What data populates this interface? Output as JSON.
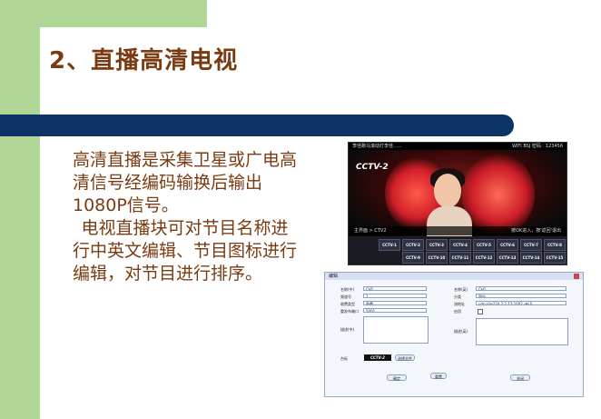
{
  "slide": {
    "title": "2、直播高清电视",
    "paragraph1": "高清直播是采集卫星或广电高清信号经编码输换后输出1080P信号。",
    "paragraph2": "电视直播块可对节目名称进行中英文编辑、节目图标进行编辑，对节目进行排序。"
  },
  "tv_screen": {
    "top_left_text": "李佳跑马滚动灯李佳……",
    "top_right_text": "WIFI BSJ 密码：123456",
    "logo": "CCTV-2",
    "nav_left": "主界面 > CTV2",
    "nav_right": "按OK进入，按'返回'退出",
    "channels": [
      "CCTV-1",
      "CCTV-2",
      "CCTV-3",
      "CCTV-4",
      "CCTV-5",
      "CCTV-6",
      "CCTV-7",
      "CCTV-8",
      "CCTV-9",
      "CCTV-10",
      "CCTV-11",
      "CCTV-12",
      "CCTV-13",
      "CCTV-14",
      "CCTV-15"
    ]
  },
  "dialog": {
    "title": "编辑",
    "labels": {
      "name_cn": "名称(中)",
      "channel_no": "频道号",
      "fee_type": "收费类型",
      "multicast_port": "重发布端口",
      "description_cn": "描述(中)",
      "icon": "台标",
      "name_en": "名称(英)",
      "category": "分类",
      "stream_url": "流地址",
      "enabled": "启用",
      "description_en": "描述(英)"
    },
    "values": {
      "name_cn": "CH1",
      "channel_no": "1",
      "fee_type": "免费",
      "multicast_port": "5001",
      "name_en": "CH1",
      "category": "国内",
      "stream_url": "udp://@224.2.2.12:1002 -HLS"
    },
    "icon_logo": "CCTV-2",
    "choose_file": "选择文件",
    "buttons": {
      "ok": "确定",
      "reset": "重置",
      "cancel": "关闭"
    }
  }
}
